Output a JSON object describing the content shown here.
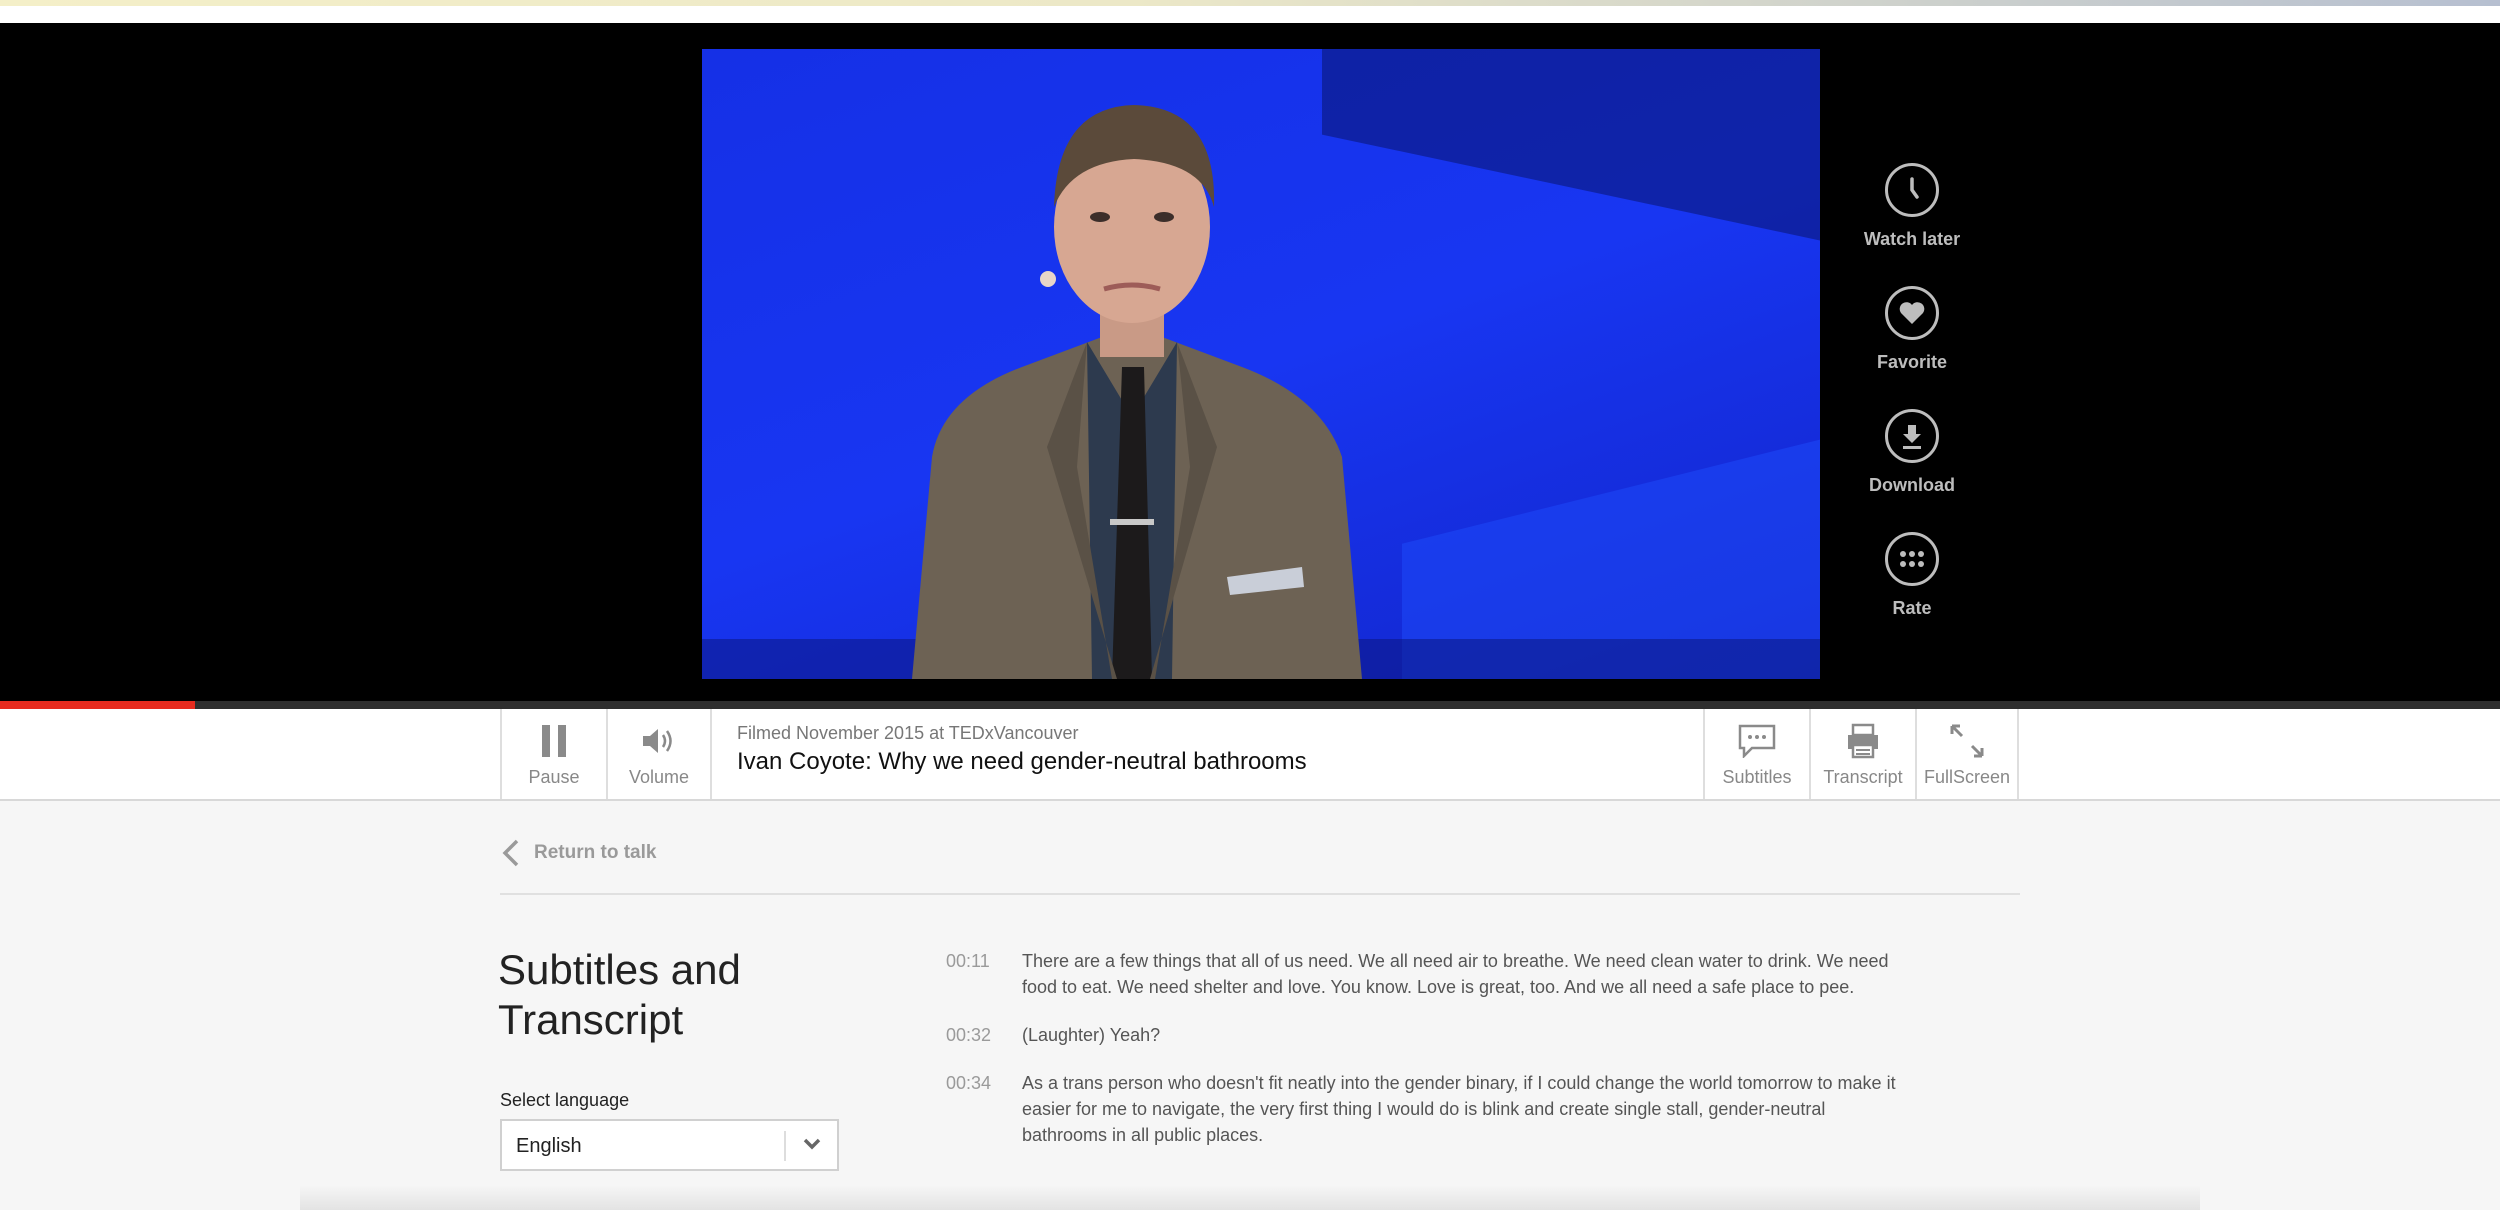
{
  "video": {
    "progress_fraction": 0.078
  },
  "side_actions": [
    {
      "label": "Watch later",
      "icon": "clock-icon"
    },
    {
      "label": "Favorite",
      "icon": "heart-icon"
    },
    {
      "label": "Download",
      "icon": "download-icon"
    },
    {
      "label": "Rate",
      "icon": "dots-icon"
    }
  ],
  "controls": {
    "pause_label": "Pause",
    "volume_label": "Volume",
    "filmed": "Filmed November 2015 at TEDxVancouver",
    "talk_title": "Ivan Coyote: Why we need gender-neutral bathrooms",
    "subtitles_label": "Subtitles",
    "transcript_label": "Transcript",
    "fullscreen_label": "FullScreen"
  },
  "page": {
    "return_label": "Return to talk",
    "heading": "Subtitles and Transcript",
    "select_label": "Select language",
    "selected_language": "English"
  },
  "transcript": [
    {
      "time": "00:11",
      "text": "There are a few things that all of us need. We all need air to breathe. We need clean water to drink. We need food to eat. We need shelter and love. You know. Love is great, too. And we all need a safe place to pee."
    },
    {
      "time": "00:32",
      "text": "(Laughter) Yeah?"
    },
    {
      "time": "00:34",
      "text": "As a trans person who doesn't fit neatly into the gender binary, if I could change the world tomorrow to make it easier for me to navigate, the very first thing I would do is blink and create single stall, gender-neutral bathrooms in all public places."
    }
  ],
  "colors": {
    "accent": "#e62b1e",
    "stage": "#000000",
    "video_blue": "#1836f2"
  }
}
